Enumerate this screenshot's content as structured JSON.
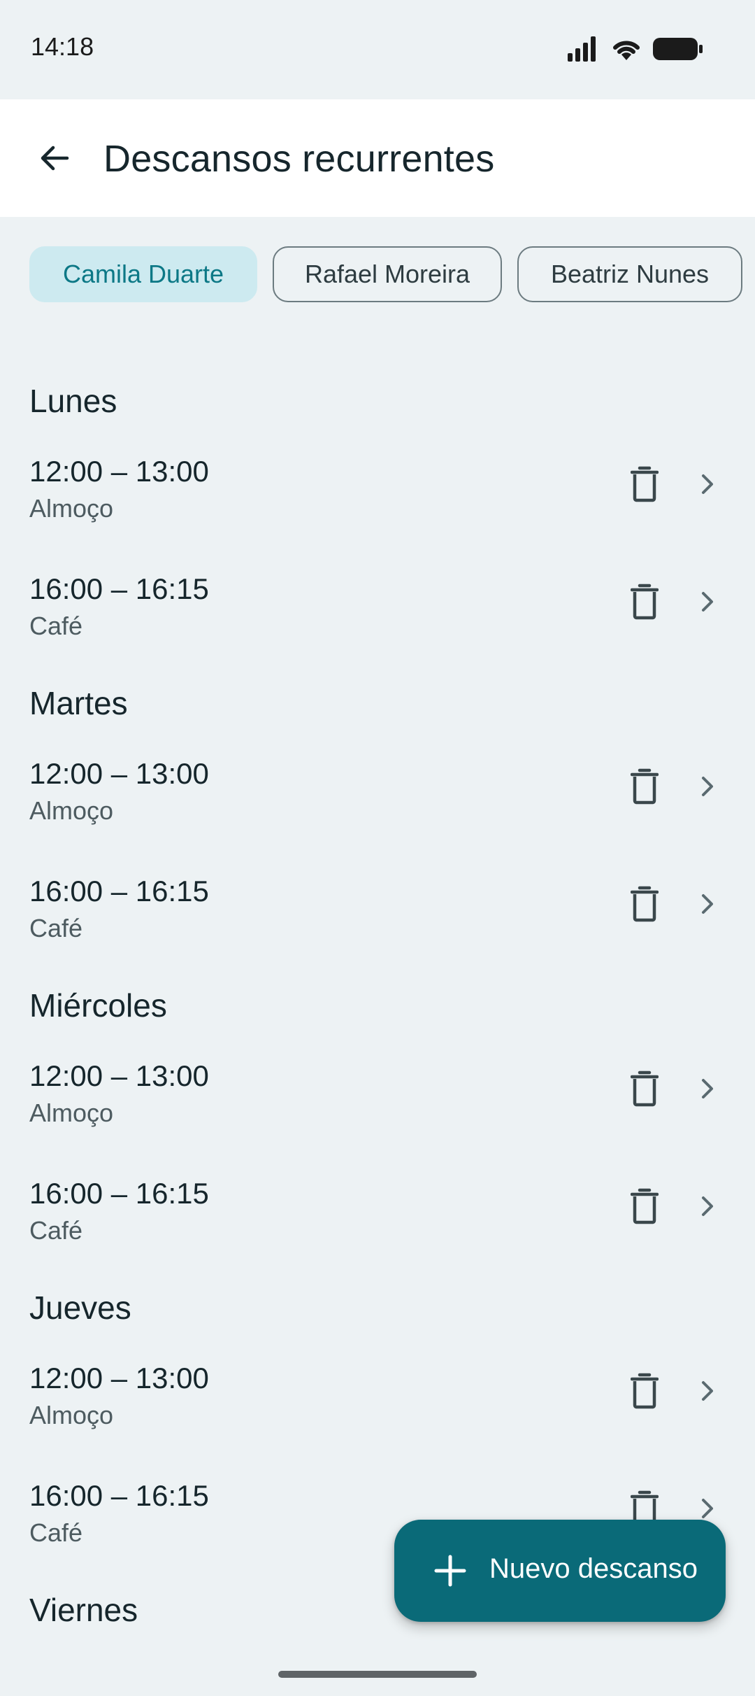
{
  "status_bar": {
    "time": "14:18"
  },
  "app_bar": {
    "title": "Descansos recurrentes"
  },
  "chips": [
    {
      "label": "Camila Duarte",
      "selected": true
    },
    {
      "label": "Rafael Moreira",
      "selected": false
    },
    {
      "label": "Beatriz Nunes",
      "selected": false
    }
  ],
  "days": [
    {
      "name": "Lunes",
      "breaks": [
        {
          "time": "12:00 – 13:00",
          "label": "Almoço"
        },
        {
          "time": "16:00 – 16:15",
          "label": "Café"
        }
      ]
    },
    {
      "name": "Martes",
      "breaks": [
        {
          "time": "12:00 – 13:00",
          "label": "Almoço"
        },
        {
          "time": "16:00 – 16:15",
          "label": "Café"
        }
      ]
    },
    {
      "name": "Miércoles",
      "breaks": [
        {
          "time": "12:00 – 13:00",
          "label": "Almoço"
        },
        {
          "time": "16:00 – 16:15",
          "label": "Café"
        }
      ]
    },
    {
      "name": "Jueves",
      "breaks": [
        {
          "time": "12:00 – 13:00",
          "label": "Almoço"
        },
        {
          "time": "16:00 – 16:15",
          "label": "Café"
        }
      ]
    },
    {
      "name": "Viernes",
      "breaks": []
    }
  ],
  "fab": {
    "label": "Nuevo descanso",
    "icon": "plus-icon"
  },
  "colors": {
    "accent": "#0a6a78",
    "chip_selected_bg": "#cdeaf0",
    "chip_selected_text": "#0c7886",
    "background": "#edf2f4"
  }
}
